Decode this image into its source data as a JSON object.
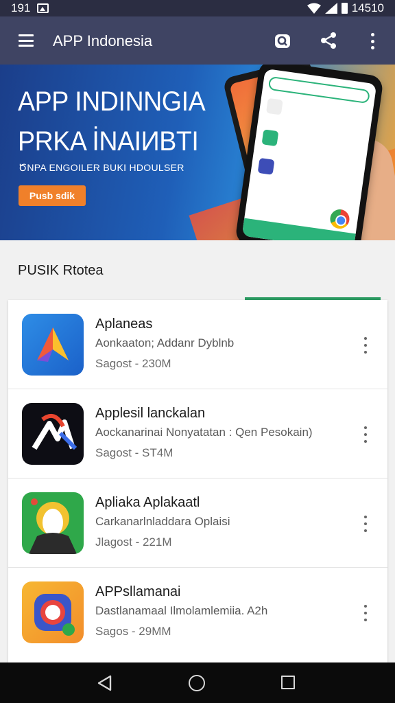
{
  "status_bar": {
    "time_left": "191",
    "time_right": "14510",
    "icons": [
      "image-icon",
      "wifi-icon",
      "signal-icon",
      "battery-icon"
    ]
  },
  "app_bar": {
    "title": "APP Indonesia",
    "icons": [
      "menu-icon",
      "search-icon",
      "share-icon",
      "more-vert-icon"
    ]
  },
  "banner": {
    "line1": "APP INDINNGIA",
    "line2": "PRKA İNAIИBTI",
    "subtitle": "ԾNPA ENGOILER BUKI HDOULSER",
    "cta": "Pusb sdik"
  },
  "section": {
    "title": "PUSIK Rtotea"
  },
  "apps": [
    {
      "name": "Aplaneas",
      "description": "Aonkaaton; Addanr Dyblnb",
      "meta": "Sagost - 230M",
      "icon": "arrow-app-icon"
    },
    {
      "name": "Applesil lanckalan",
      "description": "Aockanarinai Nonyatatan : Qen Pesokain)",
      "meta": "Sagost - ST4M",
      "icon": "mx-app-icon"
    },
    {
      "name": "Apliaka Aplakaatl",
      "description": "Carkanarlnladdara Oplaisi",
      "meta": "Jlagost - 221M",
      "icon": "mascot-app-icon"
    },
    {
      "name": "APPsllamanai",
      "description": "Dastlanamaal Ilmolamlemiia. A2h",
      "meta": "Sagos - 29MM",
      "icon": "lens-app-icon"
    }
  ],
  "colors": {
    "app_bar": "#3f4463",
    "accent": "#2b9a61",
    "cta": "#f0802a"
  }
}
